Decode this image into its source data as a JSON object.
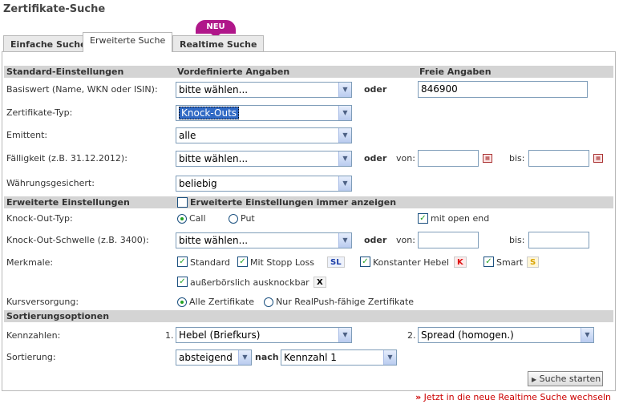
{
  "page_title": "Zertifikate-Suche",
  "tabs": [
    "Einfache Suche",
    "Erweiterte Suche",
    "Realtime Suche"
  ],
  "neu_badge": "NEU",
  "sections": {
    "standard": "Standard-Einstellungen",
    "vordefiniert": "Vordefinierte Angaben",
    "frei": "Freie Angaben",
    "erweitert": "Erweiterte Einstellungen",
    "erweitert_check": "Erweiterte Einstellungen immer anzeigen",
    "sortierung": "Sortierungsoptionen"
  },
  "labels": {
    "basiswert": "Basiswert (Name, WKN oder ISIN):",
    "typ": "Zertifikate-Typ:",
    "emittent": "Emittent:",
    "faelligkeit": "Fälligkeit (z.B. 31.12.2012):",
    "waehrung": "Währungsgesichert:",
    "ko_typ": "Knock-Out-Typ:",
    "ko_schwelle": "Knock-Out-Schwelle (z.B. 3400):",
    "merkmale": "Merkmale:",
    "kursversorgung": "Kursversorgung:",
    "kennzahlen": "Kennzahlen:",
    "sortierung": "Sortierung:",
    "oder": "oder",
    "von": "von:",
    "bis": "bis:",
    "nach": "nach",
    "num1": "1.",
    "num2": "2."
  },
  "selects": {
    "basiswert": "bitte wählen...",
    "typ": "Knock-Outs",
    "emittent": "alle",
    "faelligkeit": "bitte wählen...",
    "waehrung": "beliebig",
    "ko_schwelle": "bitte wählen...",
    "kennzahl1": "Hebel (Briefkurs)",
    "kennzahl2": "Spread (homogen.)",
    "richtung": "absteigend",
    "nach": "Kennzahl 1"
  },
  "inputs": {
    "basiswert": "846900"
  },
  "ko_options": {
    "call": "Call",
    "put": "Put",
    "open_end": "mit open end"
  },
  "merkmale": {
    "standard": "Standard",
    "stopp_loss": "Mit Stopp Loss",
    "stopp_loss_badge": "SL",
    "konstant": "Konstanter Hebel",
    "konstant_badge": "K",
    "smart": "Smart",
    "smart_badge": "S",
    "ausserb": "außerbörslich ausknockbar",
    "ausserb_badge": "X"
  },
  "kurs": {
    "alle": "Alle Zertifikate",
    "realpush": "Nur RealPush-fähige Zertifikate"
  },
  "button": "Suche starten",
  "footer_link": "Jetzt in die neue Realtime Suche wechseln",
  "colors": {
    "accent_link": "#cc0000",
    "badge": "#b0178a",
    "header_bg": "#d4d4d4"
  }
}
